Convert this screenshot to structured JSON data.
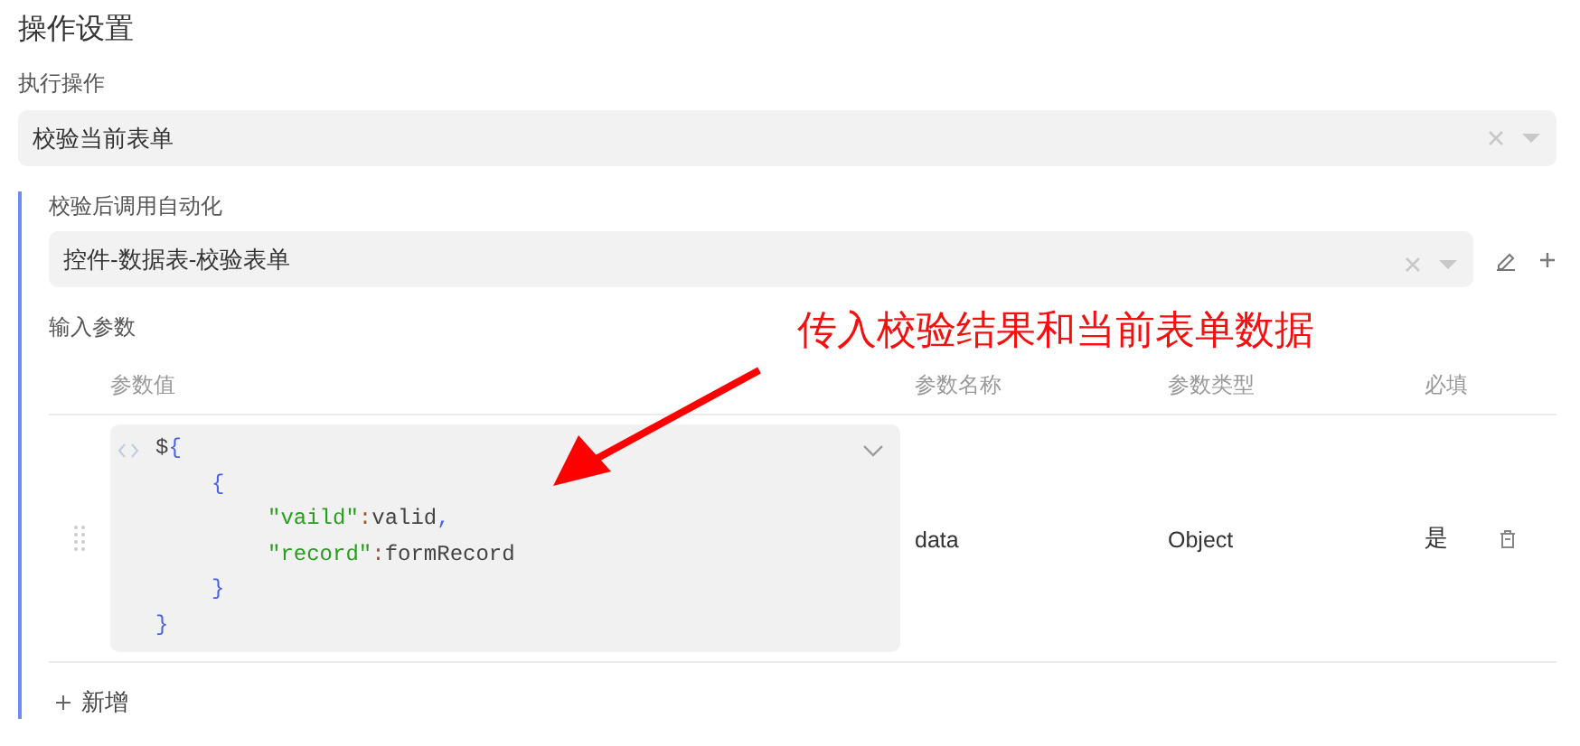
{
  "section_title": "操作设置",
  "action": {
    "label": "执行操作",
    "value": "校验当前表单"
  },
  "automation": {
    "label": "校验后调用自动化",
    "value": "控件-数据表-校验表单"
  },
  "params": {
    "label": "输入参数",
    "columns": [
      "参数值",
      "参数名称",
      "参数类型",
      "必填"
    ],
    "rows": [
      {
        "code": {
          "head": "$",
          "open": "{",
          "body": [
            {
              "kind": "block",
              "open": "{",
              "body": [
                {
                  "kind": "pair",
                  "key": "\"vaild\"",
                  "sep": ":",
                  "value": "valid",
                  "end": ","
                },
                {
                  "kind": "pair",
                  "key": "\"record\"",
                  "sep": ":",
                  "value": "formRecord"
                }
              ],
              "close": "}"
            }
          ],
          "close": "}"
        },
        "name": "data",
        "type": "Object",
        "required": "是"
      }
    ],
    "add": "新增"
  },
  "annotation": "传入校验结果和当前表单数据"
}
